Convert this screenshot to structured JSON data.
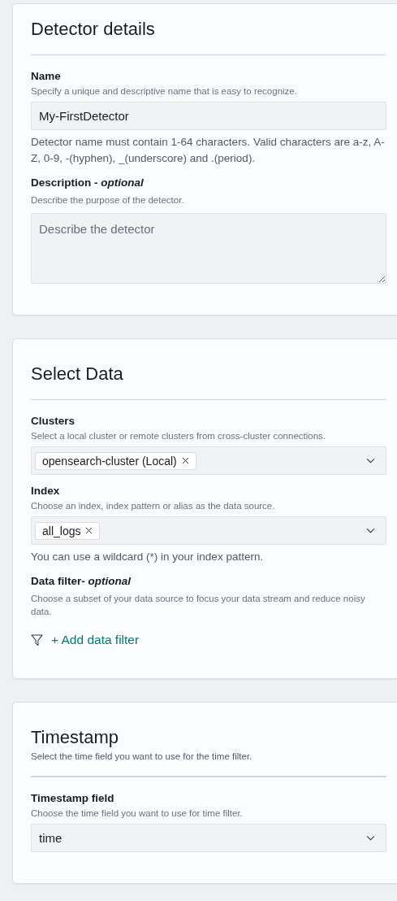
{
  "sections": [
    {
      "title": "Detector details",
      "fields": [
        {
          "kind": "text",
          "label": "Name",
          "help": "Specify a unique and descriptive name that is easy to recognize.",
          "value": "My-FirstDetector",
          "note": "Detector name must contain 1-64 characters. Valid characters are a-z, A-Z, 0-9, -(hyphen), _(underscore) and .(period)."
        },
        {
          "kind": "textarea",
          "label": "Description - *optional*",
          "help": "Describe the purpose of the detector.",
          "placeholder": "Describe the detector"
        }
      ]
    },
    {
      "title": "Select Data",
      "fields": [
        {
          "kind": "combo",
          "label": "Clusters",
          "help": "Select a local cluster or remote clusters from cross-cluster connections.",
          "chips": [
            "opensearch-cluster (Local)"
          ]
        },
        {
          "kind": "combo",
          "label": "Index",
          "help": "Choose an index, index pattern or alias as the data source.",
          "chips": [
            "all_logs"
          ],
          "note": "You can use a wildcard (*) in your index pattern."
        },
        {
          "kind": "filter",
          "label": "Data filter- *optional*",
          "help": "Choose a subset of your data source to focus your data stream and reduce noisy data.",
          "action": "+ Add data filter"
        }
      ]
    },
    {
      "title": "Timestamp",
      "subtitle": "Select the time field you want to use for the time filter.",
      "fields": [
        {
          "kind": "select",
          "label": "Timestamp field",
          "help": "Choose the time field you want to use for time filter.",
          "value": "time"
        }
      ]
    }
  ]
}
